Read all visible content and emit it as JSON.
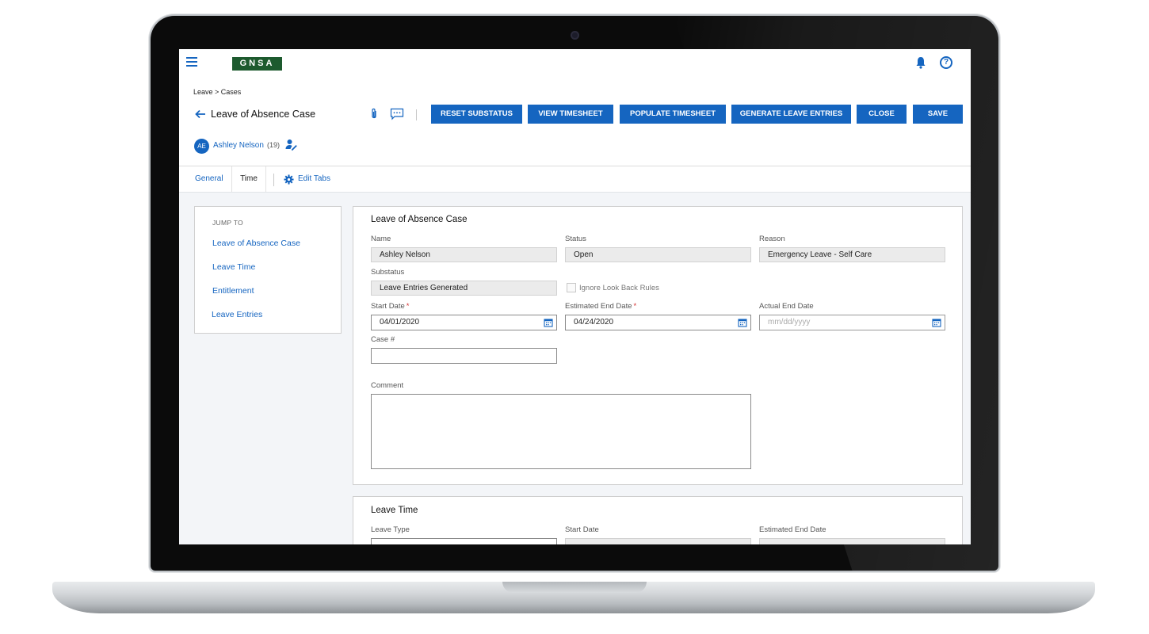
{
  "app": {
    "logo": "GNSA"
  },
  "header": {
    "breadcrumb": "Leave > Cases",
    "title": "Leave of Absence Case",
    "buttons": {
      "reset_substatus": "RESET SUBSTATUS",
      "view_timesheet": "VIEW TIMESHEET",
      "populate_timesheet": "POPULATE TIMESHEET",
      "generate_leave_entries": "GENERATE LEAVE ENTRIES",
      "close": "CLOSE",
      "save": "SAVE"
    }
  },
  "employee": {
    "initials": "AE",
    "name": "Ashley Nelson",
    "count": "(19)"
  },
  "tabs": {
    "general": "General",
    "time": "Time",
    "edit_tabs": "Edit Tabs",
    "active": "Time"
  },
  "jump_to": {
    "title": "JUMP TO",
    "links": [
      "Leave of Absence Case",
      "Leave Time",
      "Entitlement",
      "Leave Entries"
    ]
  },
  "case_section": {
    "title": "Leave of Absence Case",
    "name_label": "Name",
    "name_value": "Ashley Nelson",
    "status_label": "Status",
    "status_value": "Open",
    "reason_label": "Reason",
    "reason_value": "Emergency Leave - Self Care",
    "substatus_label": "Substatus",
    "substatus_value": "Leave Entries Generated",
    "ignore_lookback_label": "Ignore Look Back Rules",
    "ignore_lookback_checked": false,
    "start_date_label": "Start Date",
    "start_date_value": "04/01/2020",
    "est_end_date_label": "Estimated End Date",
    "est_end_date_value": "04/24/2020",
    "actual_end_date_label": "Actual End Date",
    "actual_end_date_placeholder": "mm/dd/yyyy",
    "required_mark": "*",
    "case_no_label": "Case #",
    "case_no_value": "",
    "comment_label": "Comment",
    "comment_value": ""
  },
  "leave_time_section": {
    "title": "Leave Time",
    "leave_type_label": "Leave Type",
    "start_date_label": "Start Date",
    "est_end_date_label": "Estimated End Date"
  },
  "colors": {
    "primary": "#1565c0",
    "logo_bg": "#1d5a2e",
    "required": "#d32f2f"
  },
  "icons": [
    "menu-icon",
    "bell-icon",
    "help-icon",
    "back-arrow-icon",
    "paperclip-icon",
    "comment-icon",
    "user-edit-icon",
    "gear-icon",
    "calendar-icon",
    "chevron-down-icon"
  ]
}
